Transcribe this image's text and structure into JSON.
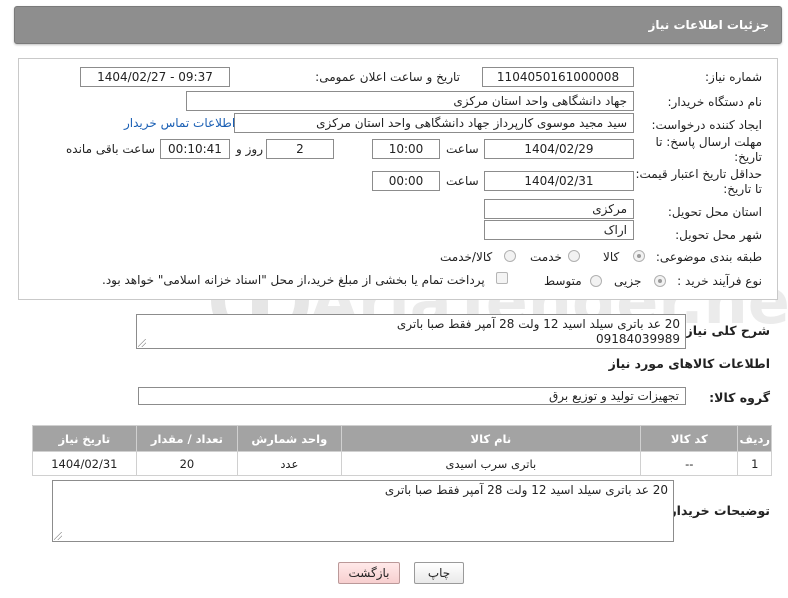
{
  "header": {
    "title": "جزئیات اطلاعات نیاز"
  },
  "form": {
    "need_number": {
      "label": "شماره نیاز:",
      "value": "1104050161000008"
    },
    "announce_datetime": {
      "label": "تاریخ و ساعت اعلان عمومی:",
      "value": "1404/02/27 - 09:37"
    },
    "buyer_org": {
      "label": "نام دستگاه خریدار:",
      "value": "جهاد دانشگاهی واحد استان مرکزی"
    },
    "requester": {
      "label": "ایجاد کننده درخواست:",
      "value": "سید مجید  موسوی  کارپرداز جهاد دانشگاهی واحد استان مرکزی"
    },
    "contact_link": "اطلاعات تماس خریدار",
    "reply_deadline": {
      "label_line1": "مهلت ارسال پاسخ: تا",
      "label_line2": "تاریخ:",
      "date": "1404/02/29",
      "time_label": "ساعت",
      "time": "10:00",
      "days": "2",
      "days_label": "روز و",
      "remaining": "00:10:41",
      "remaining_label": "ساعت باقی مانده"
    },
    "price_validity": {
      "label_line1": "حداقل تاریخ اعتبار قیمت:",
      "label_line2": "تا تاریخ:",
      "date": "1404/02/31",
      "time_label": "ساعت",
      "time": "00:00"
    },
    "delivery_province": {
      "label": "استان محل تحویل:",
      "value": "مرکزی"
    },
    "delivery_city": {
      "label": "شهر محل تحویل:",
      "value": "اراک"
    },
    "category": {
      "label": "طبقه بندی موضوعی:",
      "options": [
        "کالا",
        "خدمت",
        "کالا/خدمت"
      ]
    },
    "purchase_type": {
      "label": "نوع فرآیند خرید :",
      "options": [
        "جزیی",
        "متوسط"
      ],
      "payment_note": "پرداخت تمام یا بخشی از مبلغ خرید،از محل \"اسناد خزانه اسلامی\" خواهد بود."
    }
  },
  "description": {
    "label": "شرح کلی نیاز:",
    "line1": "20 عد باتری سیلد اسید 12 ولت 28 آمپر فقط صبا باتری",
    "line2": "09184039989"
  },
  "goods_info": {
    "title": "اطلاعات کالاهای مورد نیاز"
  },
  "goods_group": {
    "label": "گروه کالا:",
    "value": "تجهیزات تولید و توزیع برق"
  },
  "table": {
    "headers": [
      "ردیف",
      "کد کالا",
      "نام کالا",
      "واحد شمارش",
      "تعداد / مقدار",
      "تاریخ نیاز"
    ],
    "rows": [
      [
        "1",
        "--",
        "باتری سرب اسیدی",
        "عدد",
        "20",
        "1404/02/31"
      ]
    ]
  },
  "buyer_notes": {
    "label": "توضیحات خریدار:",
    "value": "20 عد باتری سیلد اسید 12 ولت 28 آمپر فقط صبا باتری"
  },
  "buttons": {
    "print": "چاپ",
    "back": "بازگشت"
  },
  "watermark": {
    "text": "AriaTender.neT"
  }
}
